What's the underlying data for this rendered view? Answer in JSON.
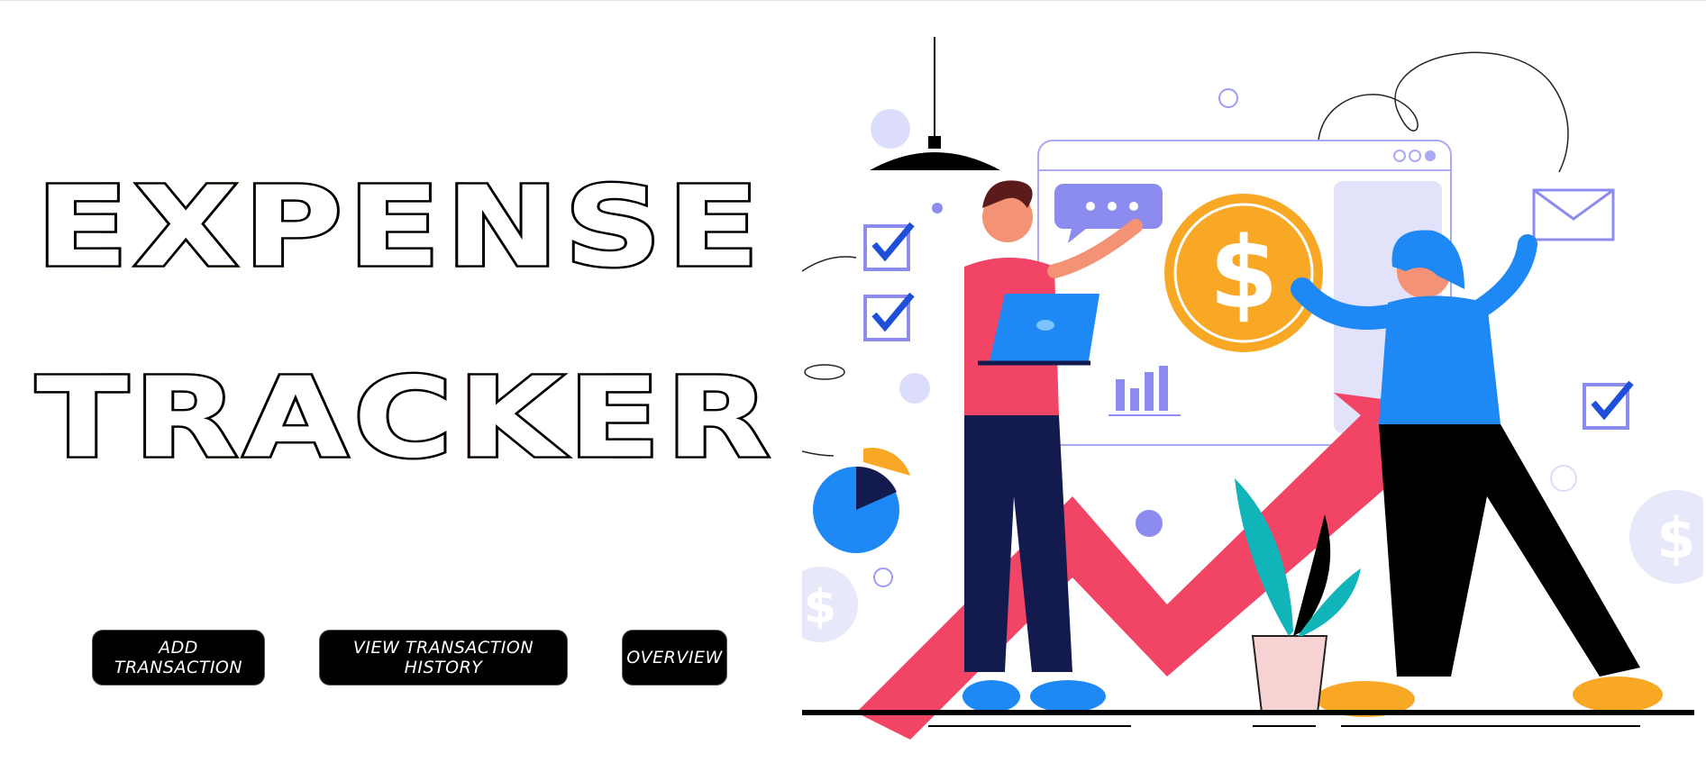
{
  "hero": {
    "title_line1": "EXPENSE",
    "title_line2": "TRACKER"
  },
  "actions": {
    "add_label": "ADD TRANSACTION",
    "history_label": "VIEW TRANSACTION HISTORY",
    "overview_label": "OVERVIEW"
  },
  "illustration": {
    "currency_symbol": "$",
    "icons": [
      "dollar-coin-icon",
      "growth-arrow-icon",
      "checkbox-icon",
      "envelope-icon",
      "chat-bubble-icon",
      "bar-chart-icon",
      "pie-chart-icon",
      "laptop-icon",
      "plant-icon",
      "pendant-lamp-icon"
    ],
    "colors": {
      "coin": "#f9a825",
      "arrow": "#f24464",
      "accent_blue": "#1e88f5",
      "lavender": "#8c8cf0",
      "navy": "#121a4e"
    }
  }
}
